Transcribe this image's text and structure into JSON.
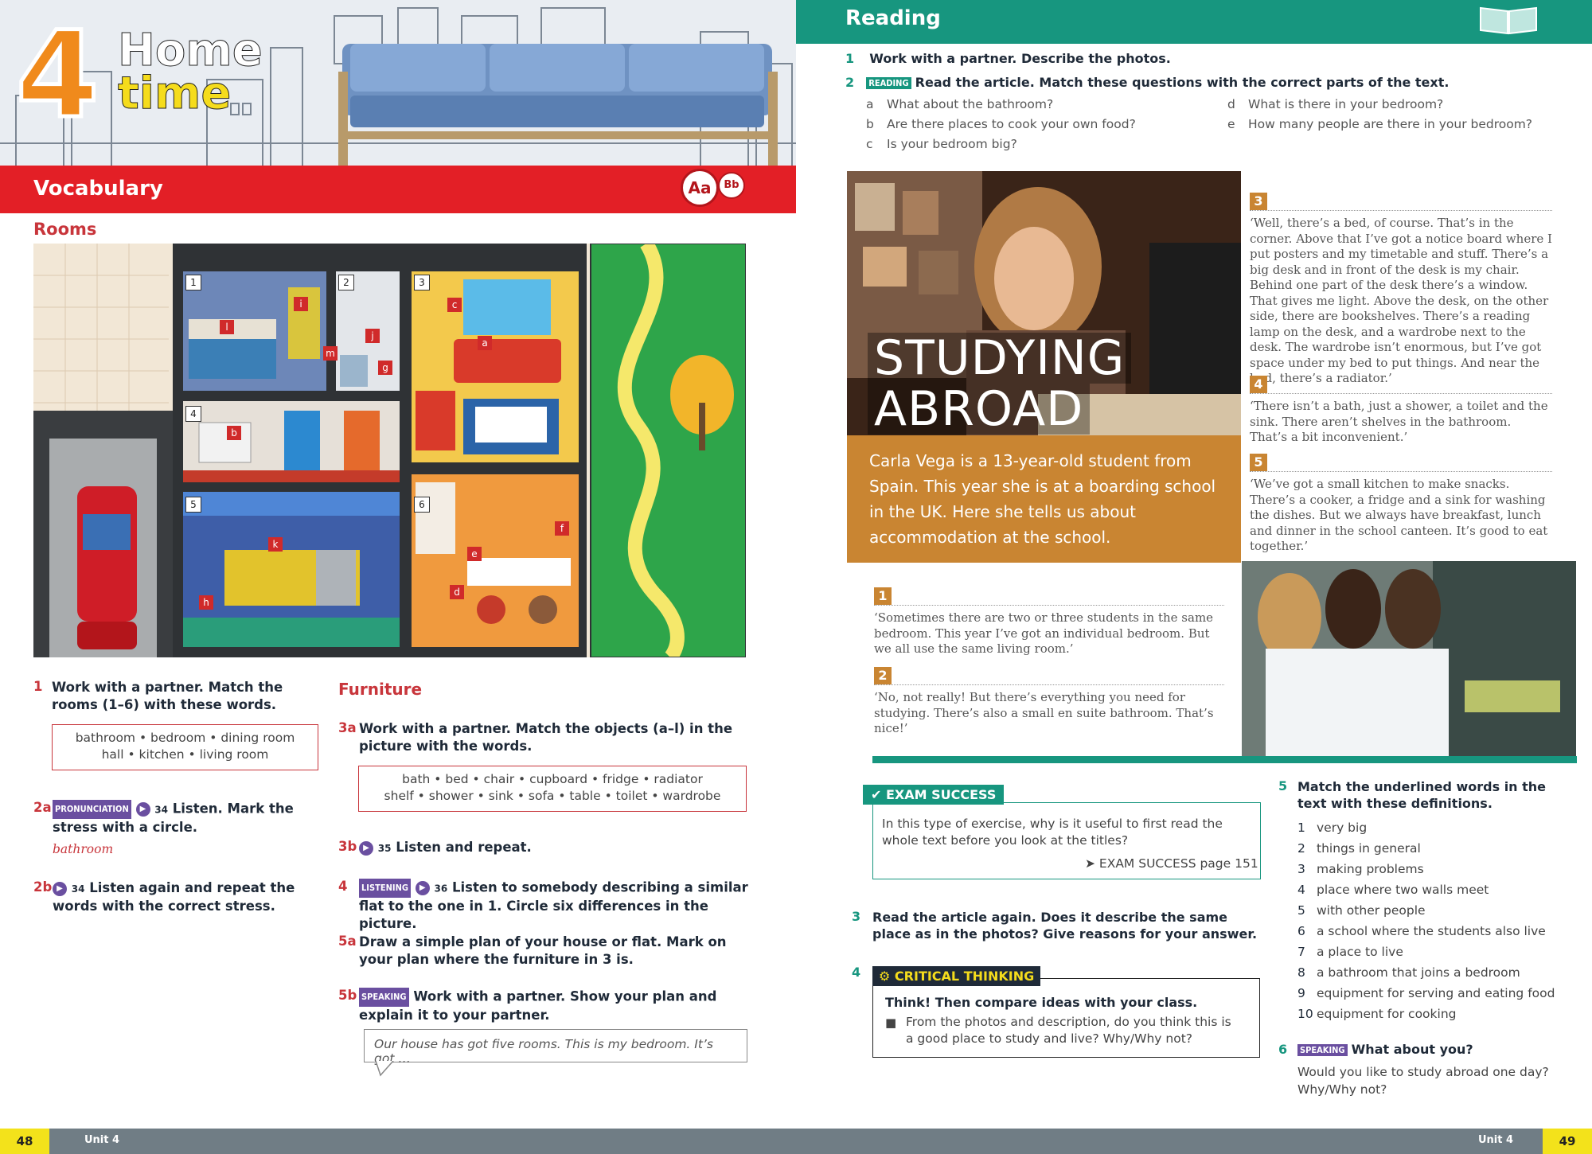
{
  "left_page": {
    "unit": {
      "number": "4",
      "title_line1": "Home",
      "title_line2": "time"
    },
    "section": "Vocabulary",
    "icons": {
      "aa": "Aa",
      "bb": "Bb"
    },
    "rooms_heading": "Rooms",
    "picture_labels": {
      "rooms": [
        "1",
        "2",
        "3",
        "4",
        "5",
        "6"
      ],
      "objects": [
        "a",
        "b",
        "c",
        "d",
        "e",
        "f",
        "g",
        "h",
        "i",
        "j",
        "k",
        "l",
        "m"
      ]
    },
    "ex1": {
      "num": "1",
      "text": "Work with a partner. Match the rooms (1–6) with these words.",
      "words_line1": "bathroom • bedroom • dining room",
      "words_line2": "hall • kitchen • living room"
    },
    "ex2a": {
      "num": "2a",
      "tag": "PRONUNCIATION",
      "track": "34",
      "text": "Listen. Mark the stress with a circle.",
      "example": "bathroom"
    },
    "ex2b": {
      "num": "2b",
      "track": "34",
      "text": "Listen again and repeat the words with the correct stress."
    },
    "furniture_heading": "Furniture",
    "ex3a": {
      "num": "3a",
      "text": "Work with a partner. Match the objects (a–l) in the picture with the words.",
      "words_line1": "bath • bed • chair • cupboard • fridge • radiator",
      "words_line2": "shelf • shower • sink • sofa • table • toilet • wardrobe"
    },
    "ex3b": {
      "num": "3b",
      "track": "35",
      "text": "Listen and repeat."
    },
    "ex4": {
      "num": "4",
      "tag": "LISTENING",
      "track": "36",
      "text": "Listen to somebody describing a similar flat to the one in 1. Circle six differences in the picture."
    },
    "ex5a": {
      "num": "5a",
      "text": "Draw a simple plan of your house or flat. Mark on your plan where the furniture in 3 is."
    },
    "ex5b": {
      "num": "5b",
      "tag": "SPEAKING",
      "text": "Work with a partner. Show your plan and explain it to your partner.",
      "bubble": "Our house has got five rooms. This is my bedroom. It’s got …"
    },
    "footer": {
      "page": "48",
      "unit": "Unit 4"
    }
  },
  "right_page": {
    "section": "Reading",
    "q1": {
      "num": "1",
      "text": "Work with a partner. Describe the photos."
    },
    "q2": {
      "num": "2",
      "tag": "READING",
      "text": "Read the article. Match these questions with the correct parts of the text."
    },
    "q2_items": [
      {
        "letter": "a",
        "text": "What about the bathroom?"
      },
      {
        "letter": "b",
        "text": "Are there places to cook your own food?"
      },
      {
        "letter": "c",
        "text": "Is your bedroom big?"
      },
      {
        "letter": "d",
        "text": "What is there in your bedroom?"
      },
      {
        "letter": "e",
        "text": "How many people are there in your bedroom?"
      }
    ],
    "article_title_1": "STUDYING",
    "article_title_2": "ABROAD",
    "intro": "Carla Vega is a 13-year-old student from Spain. This year she is at a boarding school in the UK. Here she tells us about accommodation at the school.",
    "parts": [
      {
        "num": "1",
        "text": "‘Sometimes there are two or three students in the same bedroom. This year I’ve got an individual bedroom. But we all use the same living room.’"
      },
      {
        "num": "2",
        "text": "‘No, not really! But there’s everything you need for studying. There’s also a small en suite bathroom. That’s nice!’"
      },
      {
        "num": "3",
        "text": "‘Well, there’s a bed, of course. That’s in the corner. Above that I’ve got a notice board where I put posters and my timetable and stuff. There’s a big desk and in front of the desk is my chair. Behind one part of the desk there’s a window. That gives me light. Above the desk, on the other side, there are bookshelves. There’s a reading lamp on the desk, and a wardrobe next to the desk. The wardrobe isn’t enormous, but I’ve got space under my bed to put things. And near the bed, there’s a radiator.’"
      },
      {
        "num": "4",
        "text": "‘There isn’t a bath, just a shower, a toilet and the sink. There aren’t shelves in the bathroom. That’s a bit inconvenient.’"
      },
      {
        "num": "5",
        "text": "‘We’ve got a small kitchen to make snacks. There’s a cooker, a fridge and a sink for washing the dishes. But we always have breakfast, lunch and dinner in the school canteen. It’s good to eat together.’"
      }
    ],
    "exam_success": {
      "label": "EXAM SUCCESS",
      "text": "In this type of exercise, why is it useful to first read the whole text before you look at the titles?",
      "link": "➤ EXAM SUCCESS page 151"
    },
    "q3": {
      "num": "3",
      "text": "Read the article again. Does it describe the same place as in the photos? Give reasons for your answer."
    },
    "q4": {
      "num": "4",
      "label": "CRITICAL THINKING",
      "title": "Think! Then compare ideas with your class.",
      "bullet": "From the photos and description, do you think this is a good place to study and live? Why/Why not?"
    },
    "q5": {
      "num": "5",
      "text": "Match the underlined words in the text with these definitions."
    },
    "definitions": [
      {
        "n": "1",
        "text": "very big"
      },
      {
        "n": "2",
        "text": "things in general"
      },
      {
        "n": "3",
        "text": "making problems"
      },
      {
        "n": "4",
        "text": "place where two walls meet"
      },
      {
        "n": "5",
        "text": "with other people"
      },
      {
        "n": "6",
        "text": "a school where the students also live"
      },
      {
        "n": "7",
        "text": "a place to live"
      },
      {
        "n": "8",
        "text": "a bathroom that joins a bedroom"
      },
      {
        "n": "9",
        "text": "equipment for serving and eating food"
      },
      {
        "n": "10",
        "text": "equipment for cooking"
      }
    ],
    "q6": {
      "num": "6",
      "tag": "SPEAKING",
      "title": "What about you?",
      "text": "Would you like to study abroad one day? Why/Why not?"
    },
    "footer": {
      "page": "49",
      "unit": "Unit 4"
    }
  },
  "colors": {
    "vocab_red": "#e31f26",
    "reading_teal": "#17967f",
    "unit_orange": "#f08a1c",
    "intro_orange": "#c98532",
    "page_yellow": "#f3e21b"
  }
}
